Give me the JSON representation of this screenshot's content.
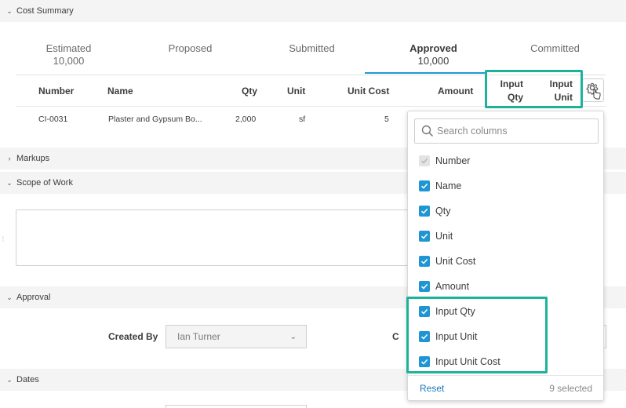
{
  "sections": {
    "cost_summary": "Cost Summary",
    "markups": "Markups",
    "scope_of_work": "Scope of Work",
    "approval": "Approval",
    "dates": "Dates"
  },
  "tabs": [
    {
      "label": "Estimated",
      "value": "10,000"
    },
    {
      "label": "Proposed",
      "value": ""
    },
    {
      "label": "Submitted",
      "value": ""
    },
    {
      "label": "Approved",
      "value": "10,000"
    },
    {
      "label": "Committed",
      "value": ""
    }
  ],
  "table": {
    "headers": {
      "number": "Number",
      "name": "Name",
      "qty": "Qty",
      "unit": "Unit",
      "unit_cost": "Unit Cost",
      "amount": "Amount",
      "input_qty_line1": "Input",
      "input_qty_line2": "Qty",
      "input_unit_line1": "Input",
      "input_unit_line2": "Unit"
    },
    "row": {
      "number": "CI-0031",
      "name": "Plaster and Gypsum Bo...",
      "qty": "2,000",
      "unit": "sf",
      "unit_cost": "5"
    }
  },
  "approval": {
    "created_by_label": "Created By",
    "created_by_value": "Ian Turner",
    "partial_label": "C"
  },
  "column_picker": {
    "search_placeholder": "Search columns",
    "options": [
      {
        "label": "Number",
        "checked": true,
        "disabled": true
      },
      {
        "label": "Name",
        "checked": true
      },
      {
        "label": "Qty",
        "checked": true
      },
      {
        "label": "Unit",
        "checked": true
      },
      {
        "label": "Unit Cost",
        "checked": true
      },
      {
        "label": "Amount",
        "checked": true
      },
      {
        "label": "Input Qty",
        "checked": true
      },
      {
        "label": "Input Unit",
        "checked": true
      },
      {
        "label": "Input Unit Cost",
        "checked": true
      }
    ],
    "reset_label": "Reset",
    "selected_count": "9 selected"
  },
  "colors": {
    "accent": "#1f96d3",
    "highlight": "#1cb39a",
    "section_bg": "#f4f4f5"
  },
  "icons": {
    "collapse": "chevron-down-icon",
    "expand": "chevron-right-icon",
    "settings": "gear-icon",
    "cursor": "hand-pointer-icon",
    "search": "search-icon",
    "check": "check-icon"
  }
}
